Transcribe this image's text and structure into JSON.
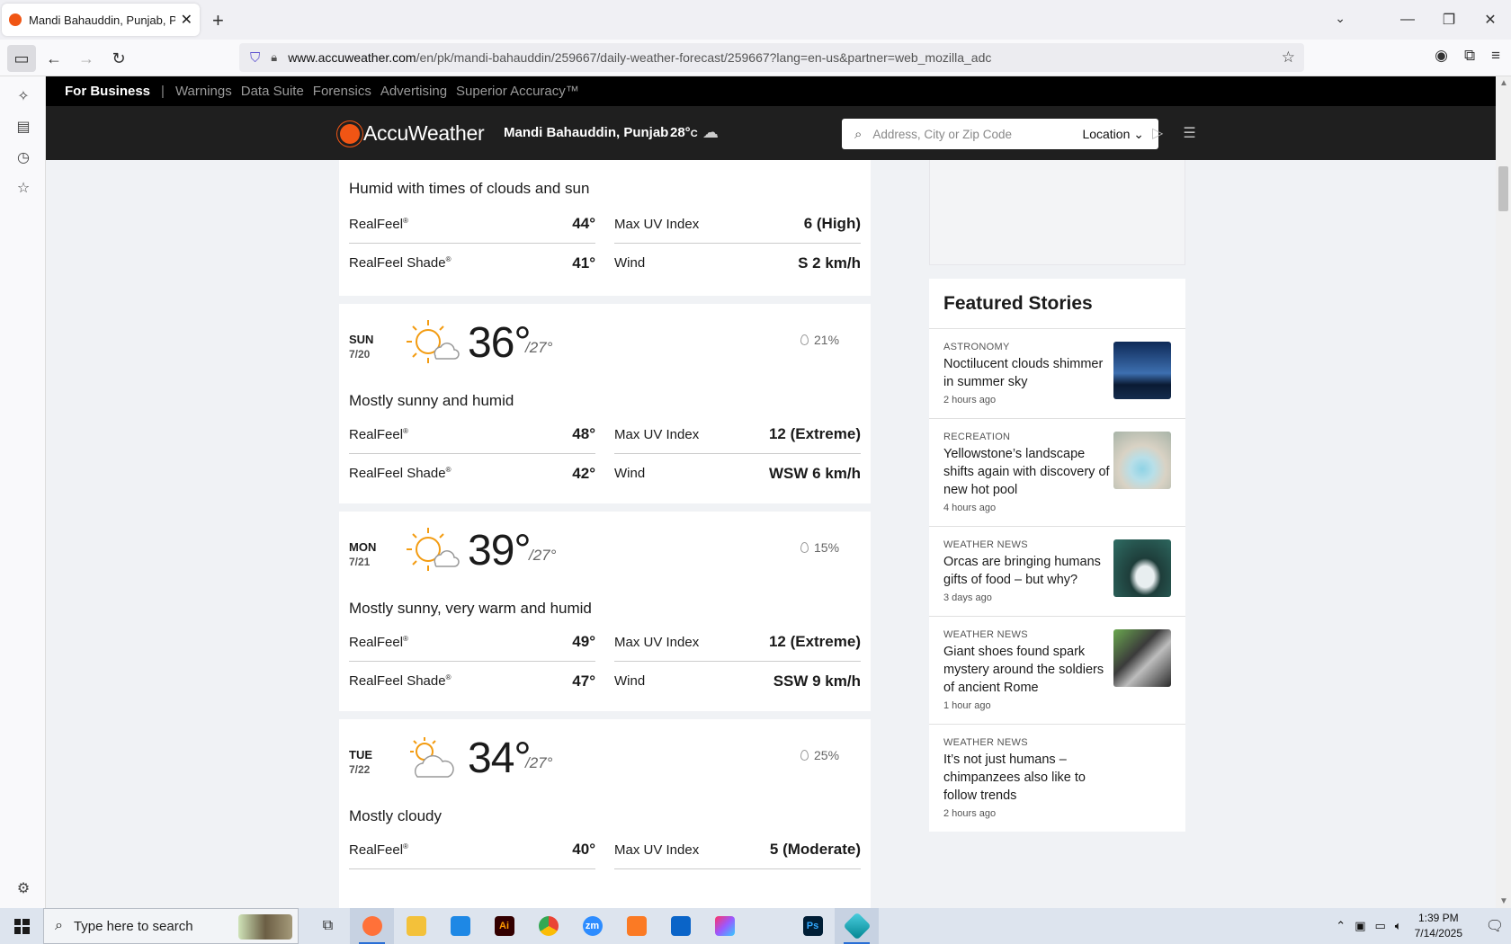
{
  "browser": {
    "tab_title": "Mandi Bahauddin, Punjab, Pakistan",
    "url_domain": "www.accuweather.com",
    "url_path": "/en/pk/mandi-bahauddin/259667/daily-weather-forecast/259667?lang=en-us&partner=web_mozilla_adc"
  },
  "topbar": {
    "business": "For Business",
    "separator": "|",
    "links": [
      "Warnings",
      "Data Suite",
      "Forensics",
      "Advertising",
      "Superior Accuracy™"
    ]
  },
  "header": {
    "logo": "AccuWeather",
    "location": "Mandi Bahauddin, Punjab",
    "temp": "28°",
    "temp_unit": "C",
    "search_placeholder": "Address, City or Zip Code",
    "location_button": "Location"
  },
  "partial_card": {
    "phrase": "Humid with times of clouds and sun",
    "realfeel": "44°",
    "realfeel_shade": "41°",
    "uv": "6 (High)",
    "wind": "S 2 km/h"
  },
  "labels": {
    "realfeel": "RealFeel",
    "realfeel_shade": "RealFeel Shade",
    "mark": "®",
    "uv": "Max UV Index",
    "wind": "Wind"
  },
  "days": [
    {
      "dow": "SUN",
      "date": "7/20",
      "hi": "36°",
      "lo": "/27°",
      "precip": "21%",
      "phrase": "Mostly sunny and humid",
      "realfeel": "48°",
      "realfeel_shade": "42°",
      "uv": "12 (Extreme)",
      "wind": "WSW 6 km/h"
    },
    {
      "dow": "MON",
      "date": "7/21",
      "hi": "39°",
      "lo": "/27°",
      "precip": "15%",
      "phrase": "Mostly sunny, very warm and humid",
      "realfeel": "49°",
      "realfeel_shade": "47°",
      "uv": "12 (Extreme)",
      "wind": "SSW 9 km/h"
    },
    {
      "dow": "TUE",
      "date": "7/22",
      "hi": "34°",
      "lo": "/27°",
      "precip": "25%",
      "phrase": "Mostly cloudy",
      "realfeel": "40°",
      "uv": "5 (Moderate)"
    }
  ],
  "featured": {
    "title": "Featured Stories",
    "stories": [
      {
        "category": "ASTRONOMY",
        "title": "Noctilucent clouds shimmer in summer sky",
        "age": "2 hours ago"
      },
      {
        "category": "RECREATION",
        "title": "Yellowstone’s landscape shifts again with discovery of new hot pool",
        "age": "4 hours ago"
      },
      {
        "category": "WEATHER NEWS",
        "title": "Orcas are bringing humans gifts of food – but why?",
        "age": "3 days ago"
      },
      {
        "category": "WEATHER NEWS",
        "title": "Giant shoes found spark mystery around the soldiers of ancient Rome",
        "age": "1 hour ago"
      },
      {
        "category": "WEATHER NEWS",
        "title": "It’s not just humans – chimpanzees also like to follow trends",
        "age": "2 hours ago"
      }
    ]
  },
  "taskbar": {
    "search_placeholder": "Type here to search",
    "apps": [
      "Firefox",
      "File Explorer",
      "VS Code",
      "Illustrator",
      "Chrome",
      "Zoom",
      "App",
      "Outlook",
      "Creative Cloud",
      "Pen",
      "Photoshop",
      "App"
    ],
    "app_glyphs": [
      "",
      "",
      "",
      "Ai",
      "",
      "zm",
      "",
      "",
      "",
      "",
      "Ps",
      ""
    ],
    "time": "1:39 PM",
    "date": "7/14/2025"
  },
  "colors": {
    "accent": "#f05514",
    "header_bg": "#1f1f1f",
    "topbar_bg": "#000000"
  }
}
